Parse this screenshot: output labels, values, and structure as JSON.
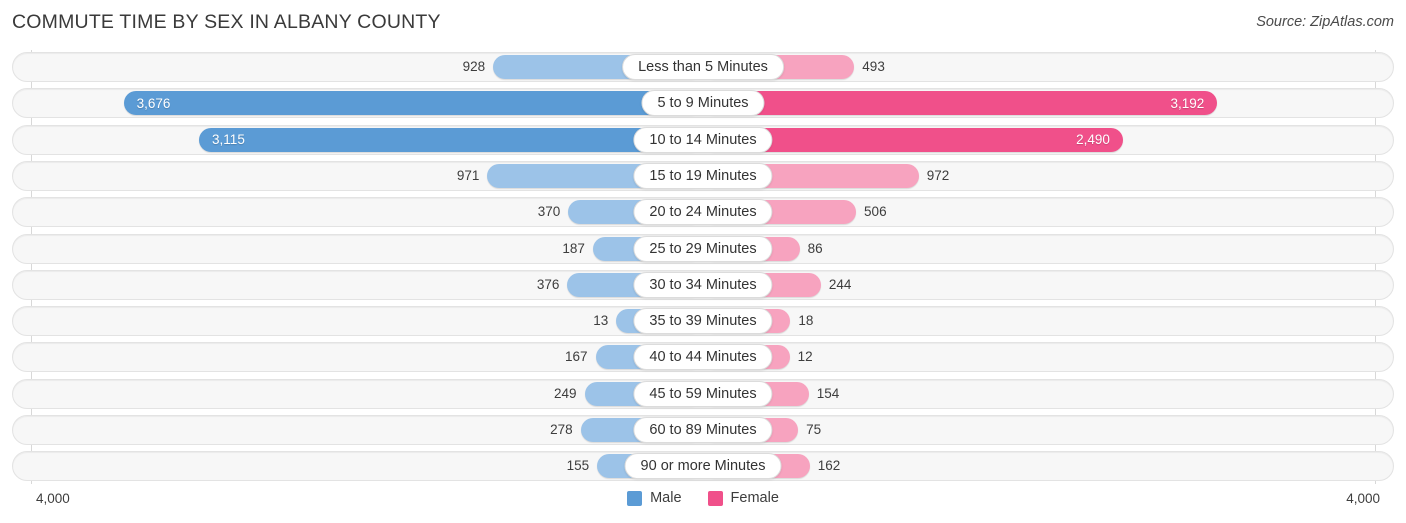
{
  "header": {
    "title": "COMMUTE TIME BY SEX IN ALBANY COUNTY",
    "source": "Source: ZipAtlas.com"
  },
  "axis": {
    "left_max_label": "4,000",
    "right_max_label": "4,000"
  },
  "legend": {
    "items": [
      {
        "label": "Male",
        "color": "#5b9bd5"
      },
      {
        "label": "Female",
        "color": "#f0508a"
      }
    ]
  },
  "colors": {
    "male_strong": "#5b9bd5",
    "male_light": "#9cc3e8",
    "female_strong": "#f0508a",
    "female_light": "#f7a3bf",
    "track": "#f7f7f7",
    "track_border": "#e3e3e3",
    "pill": "#ffffff"
  },
  "chart_data": {
    "type": "bar",
    "title": "COMMUTE TIME BY SEX IN ALBANY COUNTY",
    "subtitle": "",
    "orientation": "horizontal-diverging",
    "xlabel": "",
    "ylabel": "",
    "xlim": [
      4000,
      4000
    ],
    "axis_max": 4000,
    "grid": false,
    "legend_position": "bottom-center",
    "categories": [
      "Less than 5 Minutes",
      "5 to 9 Minutes",
      "10 to 14 Minutes",
      "15 to 19 Minutes",
      "20 to 24 Minutes",
      "25 to 29 Minutes",
      "30 to 34 Minutes",
      "35 to 39 Minutes",
      "40 to 44 Minutes",
      "45 to 59 Minutes",
      "60 to 89 Minutes",
      "90 or more Minutes"
    ],
    "series": [
      {
        "name": "Male",
        "side": "left",
        "color": "#5b9bd5",
        "values": [
          928,
          3676,
          3115,
          971,
          370,
          187,
          376,
          13,
          167,
          249,
          278,
          155
        ],
        "labels": [
          "928",
          "3,676",
          "3,115",
          "971",
          "370",
          "187",
          "376",
          "13",
          "167",
          "249",
          "278",
          "155"
        ]
      },
      {
        "name": "Female",
        "side": "right",
        "color": "#f0508a",
        "values": [
          493,
          3192,
          2490,
          972,
          506,
          86,
          244,
          18,
          12,
          154,
          75,
          162
        ],
        "labels": [
          "493",
          "3,192",
          "2,490",
          "972",
          "506",
          "86",
          "244",
          "18",
          "12",
          "154",
          "75",
          "162"
        ]
      }
    ],
    "rows": [
      {
        "category": "Less than 5 Minutes",
        "male": 928,
        "male_label": "928",
        "male_inside": false,
        "female": 493,
        "female_label": "493",
        "female_inside": false
      },
      {
        "category": "5 to 9 Minutes",
        "male": 3676,
        "male_label": "3,676",
        "male_inside": true,
        "female": 3192,
        "female_label": "3,192",
        "female_inside": true
      },
      {
        "category": "10 to 14 Minutes",
        "male": 3115,
        "male_label": "3,115",
        "male_inside": true,
        "female": 2490,
        "female_label": "2,490",
        "female_inside": true
      },
      {
        "category": "15 to 19 Minutes",
        "male": 971,
        "male_label": "971",
        "male_inside": false,
        "female": 972,
        "female_label": "972",
        "female_inside": false
      },
      {
        "category": "20 to 24 Minutes",
        "male": 370,
        "male_label": "370",
        "male_inside": false,
        "female": 506,
        "female_label": "506",
        "female_inside": false
      },
      {
        "category": "25 to 29 Minutes",
        "male": 187,
        "male_label": "187",
        "male_inside": false,
        "female": 86,
        "female_label": "86",
        "female_inside": false
      },
      {
        "category": "30 to 34 Minutes",
        "male": 376,
        "male_label": "376",
        "male_inside": false,
        "female": 244,
        "female_label": "244",
        "female_inside": false
      },
      {
        "category": "35 to 39 Minutes",
        "male": 13,
        "male_label": "13",
        "male_inside": false,
        "female": 18,
        "female_label": "18",
        "female_inside": false
      },
      {
        "category": "40 to 44 Minutes",
        "male": 167,
        "male_label": "167",
        "male_inside": false,
        "female": 12,
        "female_label": "12",
        "female_inside": false
      },
      {
        "category": "45 to 59 Minutes",
        "male": 249,
        "male_label": "249",
        "male_inside": false,
        "female": 154,
        "female_label": "154",
        "female_inside": false
      },
      {
        "category": "60 to 89 Minutes",
        "male": 278,
        "male_label": "278",
        "male_inside": false,
        "female": 75,
        "female_label": "75",
        "female_inside": false
      },
      {
        "category": "90 or more Minutes",
        "male": 155,
        "male_label": "155",
        "male_inside": false,
        "female": 162,
        "female_label": "162",
        "female_inside": false
      }
    ]
  }
}
